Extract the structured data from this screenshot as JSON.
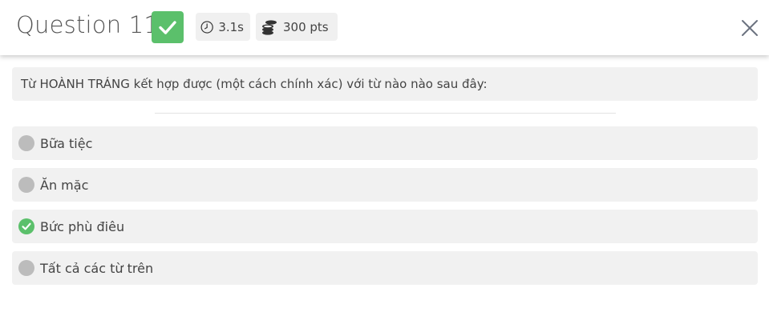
{
  "header": {
    "title": "Question 11",
    "time": "3.1s",
    "points": "300 pts",
    "status_color": "#5bc06b"
  },
  "question": {
    "text": "Từ HOÀNH TRÁNG kết hợp được (một cách chính xác) với từ nào nào sau đây:"
  },
  "options": [
    {
      "label": "Bữa tiệc",
      "correct": false
    },
    {
      "label": "Ăn mặc",
      "correct": false
    },
    {
      "label": "Bức phù điêu",
      "correct": true
    },
    {
      "label": "Tất cả các từ trên",
      "correct": false
    }
  ],
  "icons": {
    "status": "check-icon",
    "timer": "clock-icon",
    "points": "coins-icon",
    "close": "close-icon"
  }
}
